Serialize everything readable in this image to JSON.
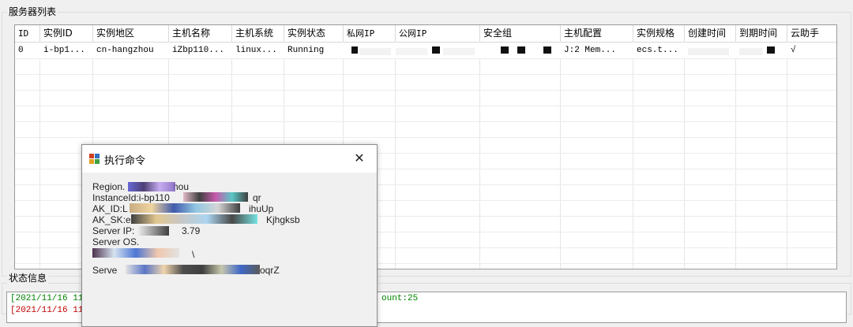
{
  "server_list": {
    "title": "服务器列表",
    "columns": [
      "ID",
      "实例ID",
      "实例地区",
      "主机名称",
      "主机系统",
      "实例状态",
      "私网IP",
      "公网IP",
      "安全组",
      "主机配置",
      "实例规格",
      "创建时间",
      "到期时间",
      "云助手"
    ],
    "row": {
      "id": "0",
      "instance_id": "i-bp1...",
      "region": "cn-hangzhou",
      "hostname": "iZbp110...",
      "os": "linux...",
      "status": "Running",
      "config": "J:2 Mem...",
      "spec": "ecs.t...",
      "assistant": "√"
    }
  },
  "status_info": {
    "title": "状态信息",
    "log_lines": [
      {
        "prefix": "[2021/11/16 11",
        "suffix": "ount:25",
        "color": "#008000"
      },
      {
        "prefix": "[2021/11/16 11",
        "suffix": "",
        "color": "#c00000"
      }
    ]
  },
  "dialog": {
    "title": "执行命令",
    "close_glyph": "✕",
    "lines": [
      "Region.",
      "hou",
      "InstanceId:i-bp110",
      "qr",
      "AK_ID:L",
      "ihuUp",
      "AK_SK:e",
      "Kjhgksb",
      "Server IP:",
      "3.79",
      "Server OS.",
      "\\",
      "Serve",
      "oqrZ"
    ]
  }
}
